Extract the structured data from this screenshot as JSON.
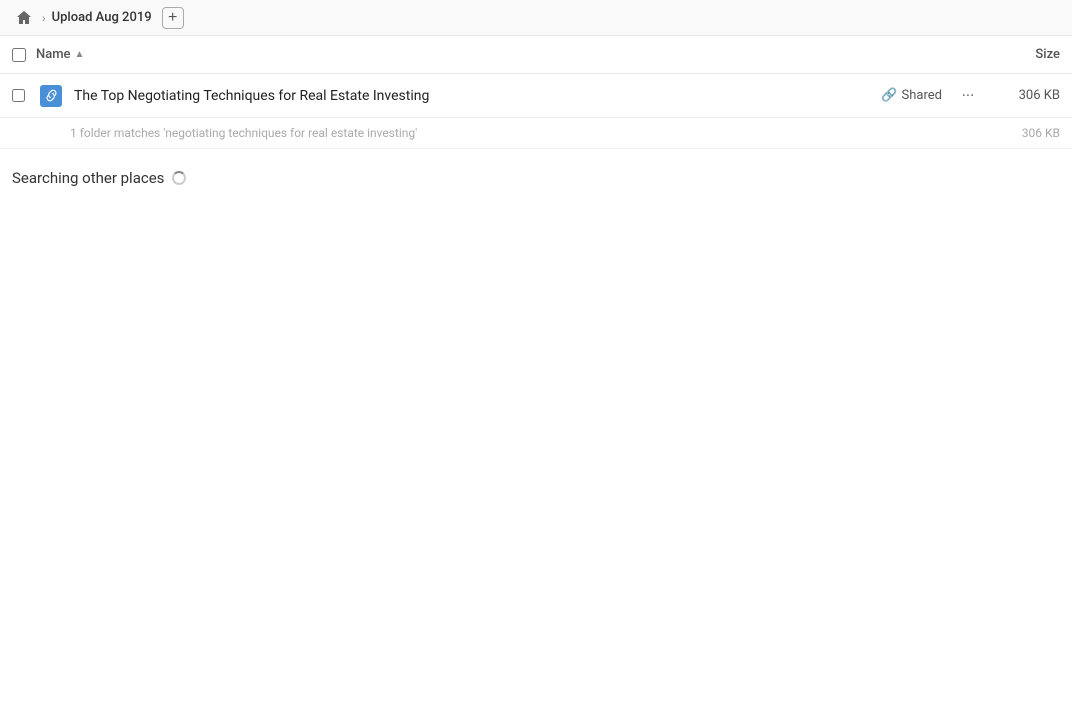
{
  "topbar": {
    "home_title": "Upload Aug 2019",
    "add_button_label": "+"
  },
  "columns": {
    "name_label": "Name",
    "size_label": "Size"
  },
  "file_row": {
    "name": "The Top Negotiating Techniques for Real Estate Investing",
    "shared_label": "Shared",
    "size": "306 KB",
    "more_label": "···"
  },
  "match_summary": {
    "text": "1 folder matches 'negotiating techniques for real estate investing'",
    "size": "306 KB"
  },
  "other_places": {
    "label": "Searching other places"
  }
}
